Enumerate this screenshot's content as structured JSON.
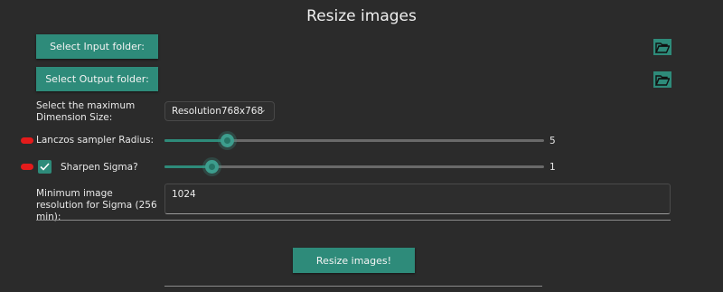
{
  "app": {
    "title": "Resize images"
  },
  "input_folder": {
    "button_label": "Select Input folder:",
    "icon": "folder-open-icon"
  },
  "output_folder": {
    "button_label": "Select Output folder:",
    "icon": "folder-open-icon"
  },
  "max_dimension": {
    "label": "Select the maximum Dimension Size:",
    "selected": "Resolution768x768"
  },
  "lanczos": {
    "label": "Lanczos sampler Radius:",
    "value": "5",
    "fraction": 0.165
  },
  "sharpen": {
    "label": "Sharpen Sigma?",
    "checked": true,
    "value": "1",
    "fraction": 0.125
  },
  "min_resolution": {
    "label": "Minimum image resolution for Sigma (256 min):",
    "value": "1024"
  },
  "actions": {
    "resize_label": "Resize images!"
  },
  "colors": {
    "accent": "#2e8b7a",
    "background": "#2b2b2b",
    "marker": "#e41b1b"
  }
}
